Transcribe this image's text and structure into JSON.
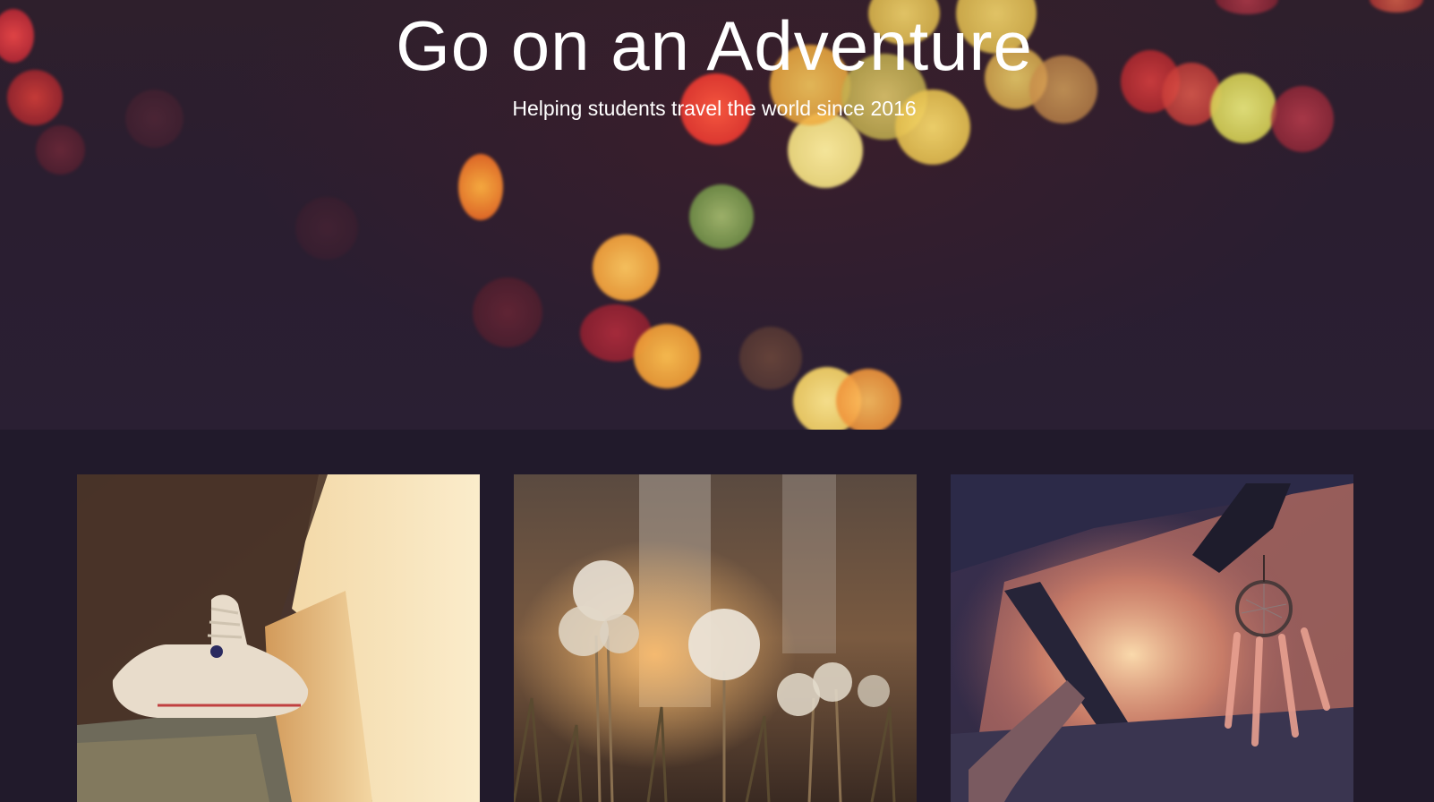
{
  "hero": {
    "title": "Go on an Adventure",
    "subtitle": "Helping students travel the world since 2016"
  },
  "gallery": {
    "photos": [
      {
        "name": "sneakers-on-wall-photo"
      },
      {
        "name": "dandelions-photo"
      },
      {
        "name": "dreamcatcher-car-photo"
      }
    ]
  },
  "colors": {
    "page_background": "#211a2b",
    "text": "#ffffff"
  }
}
